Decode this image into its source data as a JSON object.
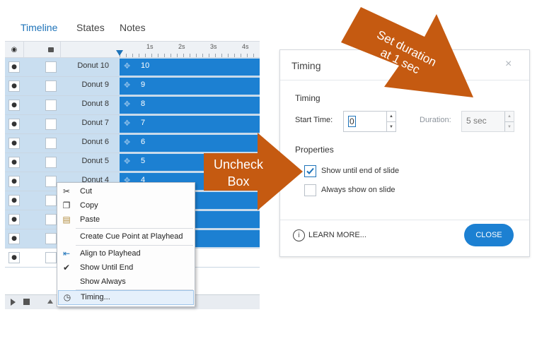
{
  "timeline": {
    "tabs": [
      {
        "label": "Timeline",
        "active": true
      },
      {
        "label": "States",
        "active": false
      },
      {
        "label": "Notes",
        "active": false
      }
    ],
    "ruler_labels": [
      "1s",
      "2s",
      "3s",
      "4s"
    ],
    "rows": [
      {
        "name": "Donut 10",
        "bar_label": "10",
        "selected": true
      },
      {
        "name": "Donut 9",
        "bar_label": "9",
        "selected": true
      },
      {
        "name": "Donut 8",
        "bar_label": "8",
        "selected": true
      },
      {
        "name": "Donut 7",
        "bar_label": "7",
        "selected": true
      },
      {
        "name": "Donut 6",
        "bar_label": "6",
        "selected": true
      },
      {
        "name": "Donut 5",
        "bar_label": "5",
        "selected": true
      },
      {
        "name": "Donut 4",
        "bar_label": "4",
        "selected": true
      },
      {
        "name": "",
        "bar_label": "",
        "selected": true
      },
      {
        "name": "",
        "bar_label": "",
        "selected": true
      },
      {
        "name": "",
        "bar_label": "",
        "selected": true
      },
      {
        "name": "",
        "bar_label": "",
        "selected": false
      }
    ]
  },
  "context_menu": {
    "items": {
      "cut": "Cut",
      "copy": "Copy",
      "paste": "Paste",
      "create_cue": "Create Cue Point at Playhead",
      "align": "Align to Playhead",
      "show_until_end": "Show Until End",
      "show_always": "Show Always",
      "timing": "Timing..."
    }
  },
  "dialog": {
    "title": "Timing",
    "section_timing": "Timing",
    "start_time_label": "Start Time:",
    "start_time_value": "0",
    "duration_label": "Duration:",
    "duration_value": "5 sec",
    "section_properties": "Properties",
    "show_until_end_label": "Show until end of slide",
    "show_until_end_checked": true,
    "always_show_label": "Always show on slide",
    "always_show_checked": false,
    "learn_more": "LEARN MORE...",
    "close_label": "CLOSE"
  },
  "callouts": {
    "duration_line1": "Set duration",
    "duration_line2": "at 1 sec",
    "uncheck_line1": "Uncheck",
    "uncheck_line2": "Box",
    "color": "#c55a11"
  },
  "colors": {
    "accent": "#1c80d2",
    "row_selected": "#c9def0"
  }
}
